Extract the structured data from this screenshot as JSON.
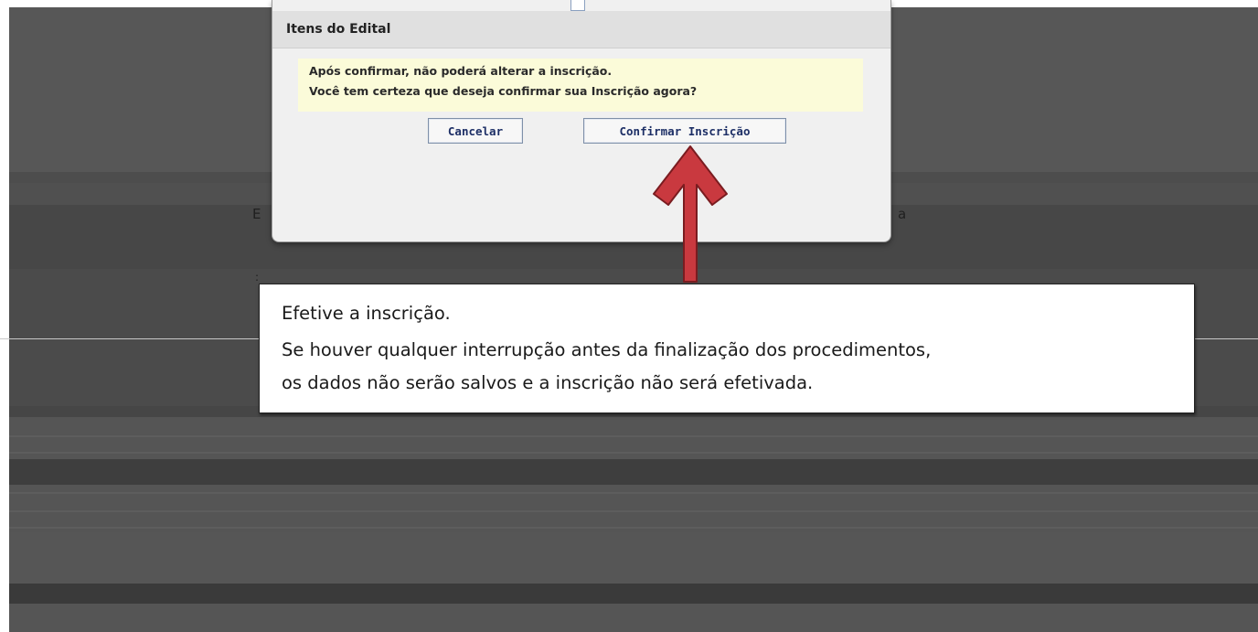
{
  "dialog": {
    "title": "Itens do Edital",
    "warning_line1": "Após confirmar, não poderá alterar a inscrição.",
    "warning_line2": "Você tem certeza que deseja confirmar sua Inscrição agora?",
    "cancel_label": "Cancelar",
    "confirm_label": "Confirmar Inscrição"
  },
  "background": {
    "fragment_left": "E",
    "fragment_right": "a",
    "fragment_small": ":"
  },
  "callout": {
    "line1": "Efetive a inscrição.",
    "line2": "Se houver qualquer interrupção antes da finalização dos procedimentos,",
    "line3": "os dados não serão salvos e a inscrição não será efetivada."
  },
  "colors": {
    "arrow": "#c9393f",
    "warning_bg": "#fbfbd9",
    "button_text": "#1d2f66",
    "overlay": "#555555"
  }
}
